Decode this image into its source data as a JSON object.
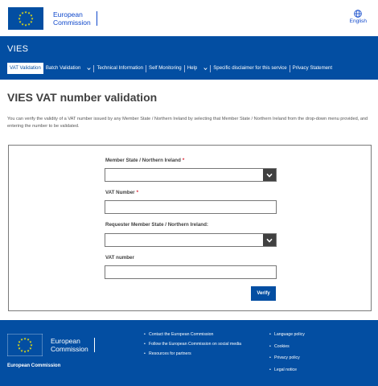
{
  "header": {
    "logo_line1": "European",
    "logo_line2": "Commission",
    "language_label": "English"
  },
  "site": {
    "name": "VIES"
  },
  "nav": {
    "items": [
      {
        "label": "VAT Validation",
        "active": true
      },
      {
        "label": "Batch Validation",
        "dropdown": true
      },
      {
        "label": "Technical Information"
      },
      {
        "label": "Self Monitoring"
      },
      {
        "label": "Help",
        "dropdown": true
      },
      {
        "label": "Specific disclaimer for this service"
      },
      {
        "label": "Privacy Statement"
      }
    ]
  },
  "main": {
    "title": "VIES VAT number validation",
    "intro": "You can verify the validity of a VAT number issued by any Member State / Northern Ireland by selecting that Member State / Northern Ireland from the drop-down menu provided, and entering the number to be validated."
  },
  "form": {
    "member_state_label": "Member State / Northern Ireland",
    "member_state_value": "",
    "vat_number_label": "VAT Number",
    "vat_number_value": "",
    "requester_state_label": "Requester Member State / Northern Ireland:",
    "requester_state_value": "",
    "requester_vat_label": "VAT number",
    "requester_vat_value": "",
    "required_marker": "*",
    "verify_label": "Verify"
  },
  "footer": {
    "logo_line1": "European",
    "logo_line2": "Commission",
    "org_name": "European Commission",
    "col1": [
      "Contact the European Commission",
      "Follow the European Commission on social media",
      "Resources for partners"
    ],
    "col2": [
      "Language policy",
      "Cookies",
      "Privacy policy",
      "Legal notice"
    ]
  },
  "colors": {
    "primary_blue": "#034ea2",
    "required_red": "#da2131",
    "text_dark": "#404040"
  }
}
